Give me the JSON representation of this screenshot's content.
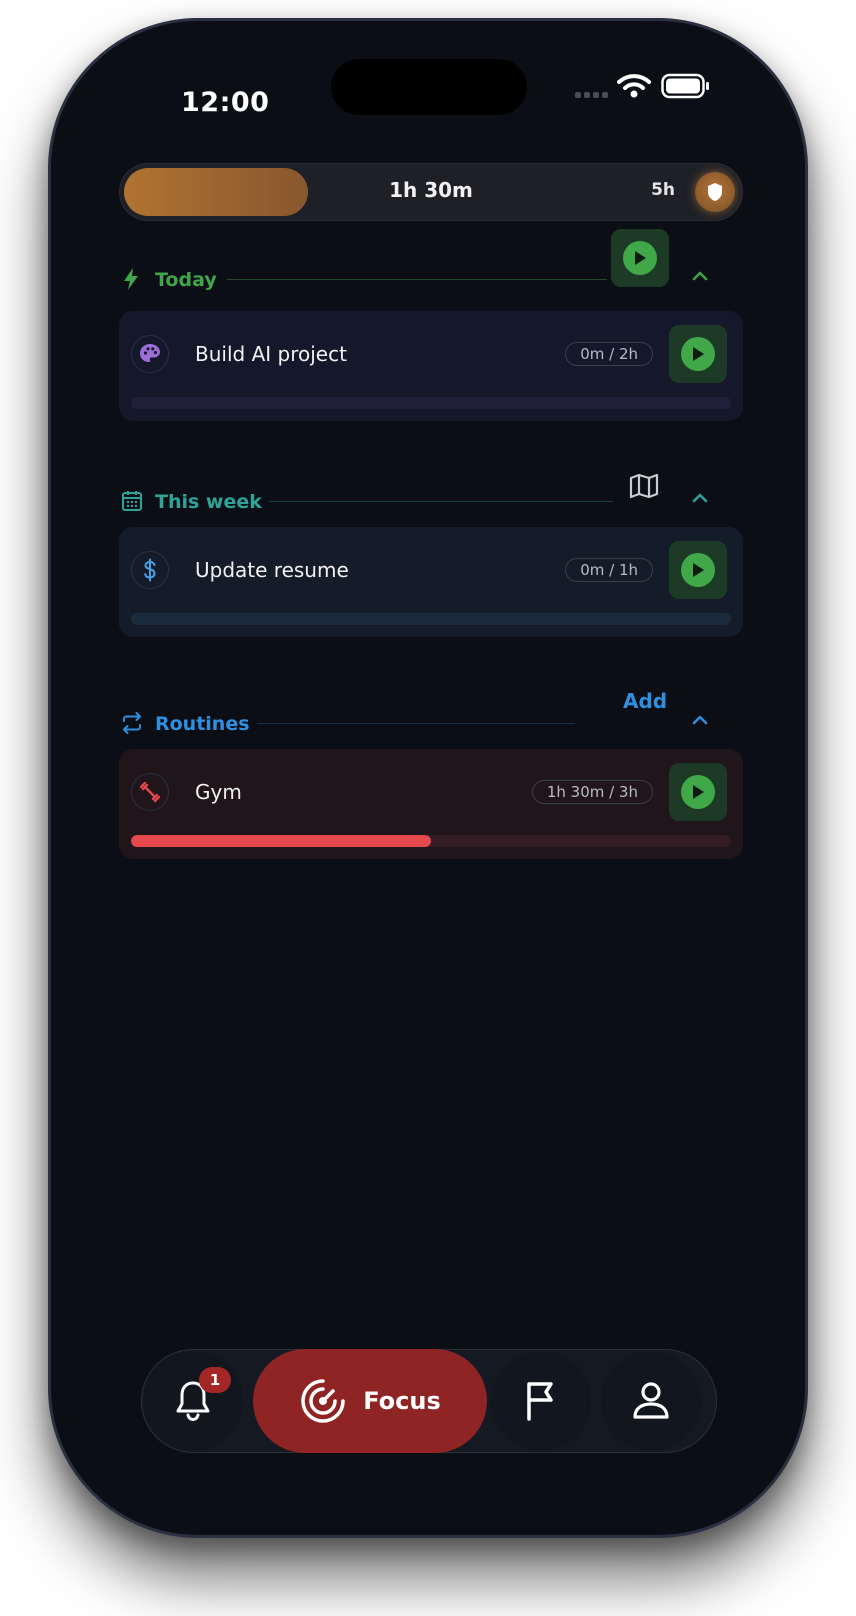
{
  "status_bar": {
    "time": "12:00"
  },
  "progress": {
    "logged": "1h 30m",
    "goal": "5h",
    "fill_fraction": 0.3
  },
  "sections": {
    "today": {
      "title": "Today",
      "color": "#3fa64b",
      "task": {
        "title": "Build AI project",
        "chip": "0m / 2h",
        "progress_fraction": 0
      }
    },
    "this_week": {
      "title": "This week",
      "color": "#2fa39a",
      "task": {
        "title": "Update resume",
        "chip": "0m / 1h",
        "progress_fraction": 0
      }
    },
    "routines": {
      "title": "Routines",
      "color": "#2f8fe0",
      "add_label": "Add",
      "task": {
        "title": "Gym",
        "chip": "1h 30m / 3h",
        "progress_fraction": 0.5
      }
    }
  },
  "nav": {
    "notifications_count": "1",
    "focus_label": "Focus"
  },
  "colors": {
    "accent_orange": "#b27331",
    "play_green": "#41a84a",
    "routine_red": "#e5484d",
    "focus_red": "#8e2424"
  }
}
